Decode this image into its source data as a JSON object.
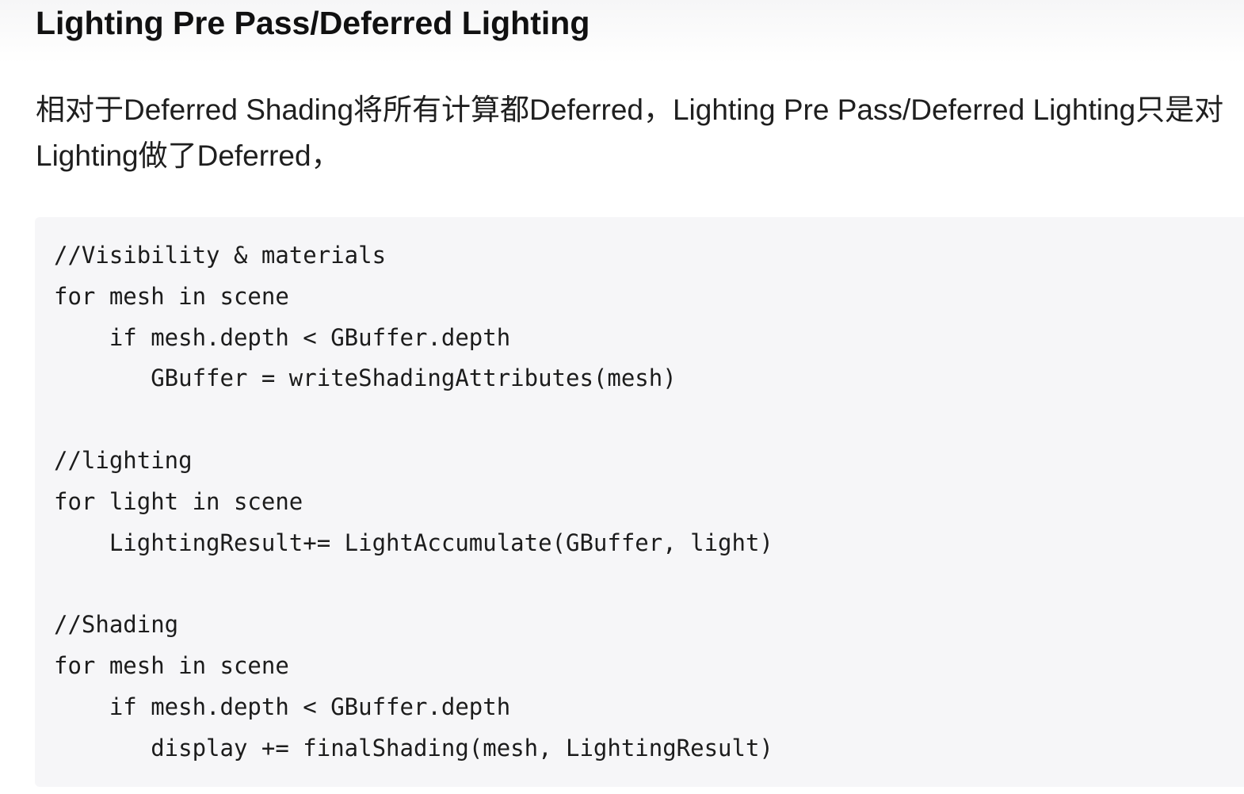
{
  "heading": "Lighting Pre Pass/Deferred Lighting",
  "paragraph": {
    "line1": "相对于Deferred Shading将所有计算都Deferred，Lighting Pre Pass/Deferred Lighting只是对",
    "line2": "Lighting做了Deferred，"
  },
  "code": {
    "lines": [
      "//Visibility & materials",
      "for mesh in scene",
      "    if mesh.depth < GBuffer.depth",
      "       GBuffer = writeShadingAttributes(mesh)",
      "",
      "//lighting",
      "for light in scene",
      "    LightingResult+= LightAccumulate(GBuffer, light)",
      "",
      "//Shading",
      "for mesh in scene",
      "    if mesh.depth < GBuffer.depth",
      "       display += finalShading(mesh, LightingResult)"
    ]
  }
}
